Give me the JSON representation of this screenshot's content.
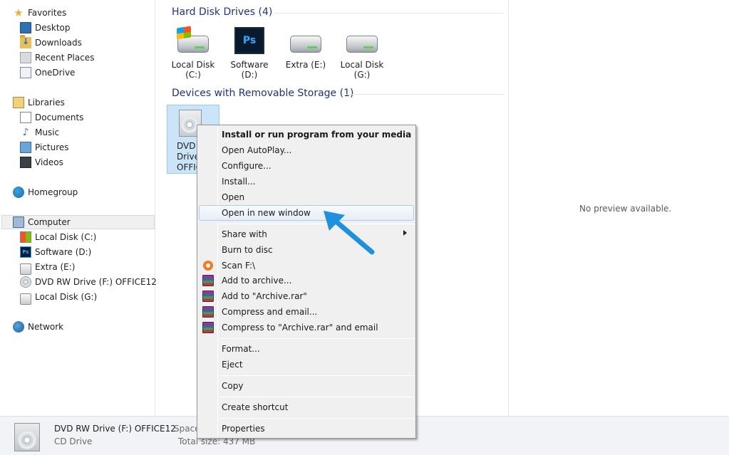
{
  "sidebar": {
    "favorites": {
      "label": "Favorites",
      "items": [
        "Desktop",
        "Downloads",
        "Recent Places",
        "OneDrive"
      ]
    },
    "libraries": {
      "label": "Libraries",
      "items": [
        "Documents",
        "Music",
        "Pictures",
        "Videos"
      ]
    },
    "homegroup": {
      "label": "Homegroup"
    },
    "computer": {
      "label": "Computer",
      "items": [
        "Local Disk (C:)",
        "Software (D:)",
        "Extra (E:)",
        "DVD RW Drive (F:) OFFICE12",
        "Local Disk (G:)"
      ]
    },
    "network": {
      "label": "Network"
    }
  },
  "main": {
    "hard_disk_header": "Hard Disk Drives (4)",
    "drives": [
      {
        "name": "Local Disk",
        "letter": "(C:)"
      },
      {
        "name": "Software",
        "letter": "(D:)"
      },
      {
        "name": "Extra (E:)",
        "letter": ""
      },
      {
        "name": "Local Disk",
        "letter": "(G:)"
      }
    ],
    "removable_header": "Devices with Removable Storage (1)",
    "dvd": {
      "line1": "DVD",
      "line2": "Drive",
      "line3": "OFFIC"
    },
    "ps_glyph": "Ps"
  },
  "preview": {
    "text": "No preview available."
  },
  "details": {
    "title": "DVD RW Drive (F:) OFFICE12",
    "subtitle": "CD Drive",
    "space_label": "Space",
    "total_size": "Total size: 437 MB"
  },
  "context_menu": {
    "items": [
      "Install or run program from your media",
      "Open AutoPlay...",
      "Configure...",
      "Install...",
      "Open",
      "Open in new window",
      "Share with",
      "Burn to disc",
      "Scan F:\\",
      "Add to archive...",
      "Add to \"Archive.rar\"",
      "Compress and email...",
      "Compress to \"Archive.rar\" and email",
      "Format...",
      "Eject",
      "Copy",
      "Create shortcut",
      "Properties"
    ]
  },
  "colors": {
    "accent": "#1e3287",
    "selection": "#cce4f7",
    "annotation_arrow": "#1e90e0"
  }
}
